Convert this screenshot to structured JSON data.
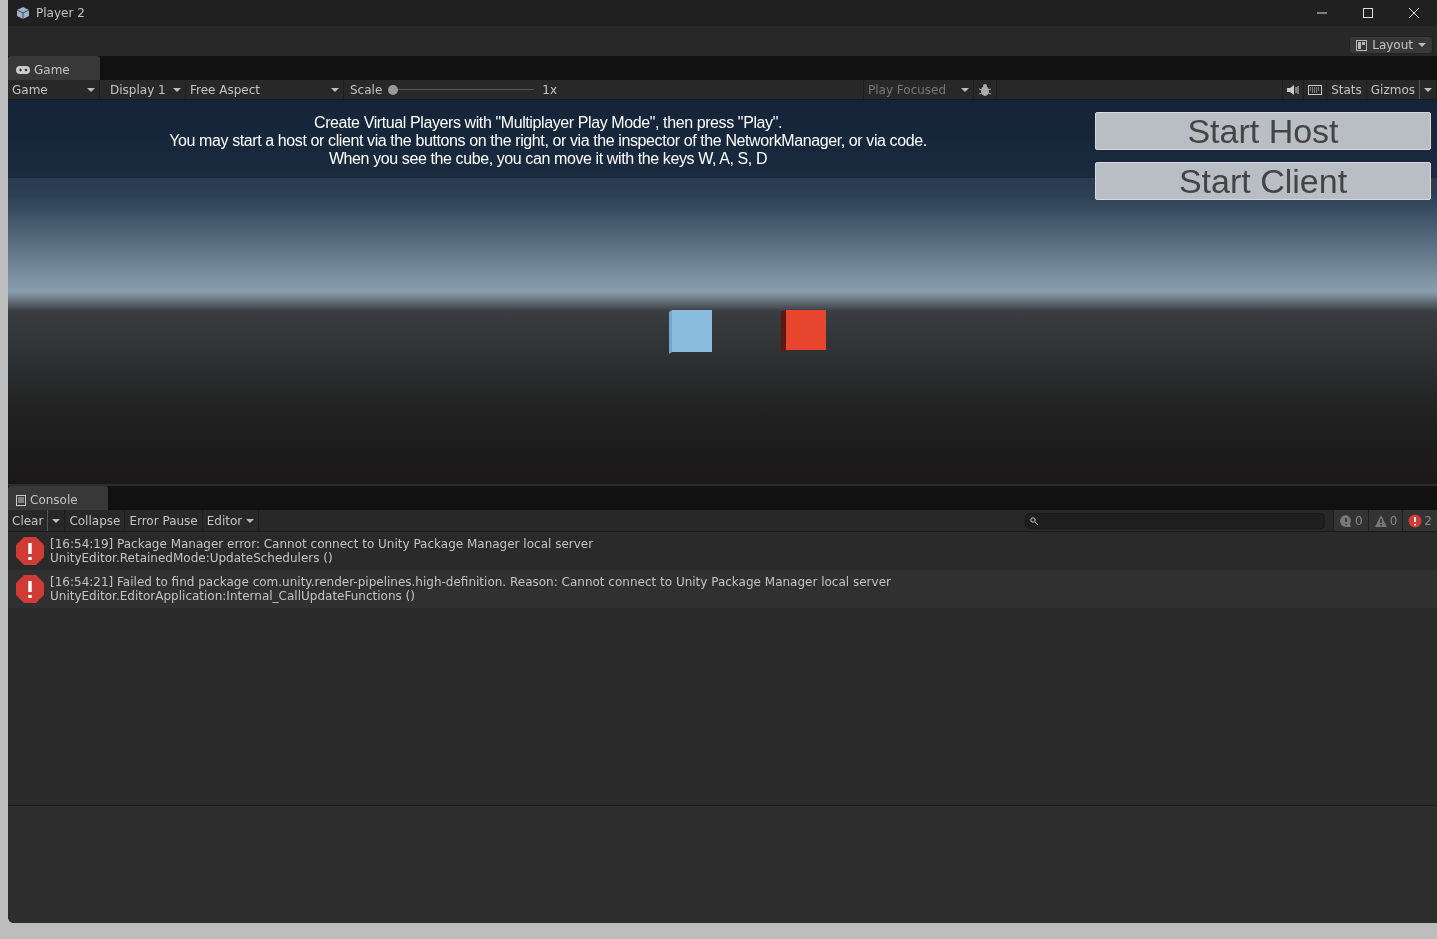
{
  "window": {
    "title": "Player 2"
  },
  "layout_button": {
    "label": "Layout"
  },
  "game_tab": {
    "label": "Game"
  },
  "game_toolbar": {
    "view": "Game",
    "display": "Display 1",
    "aspect": "Free Aspect",
    "scale": {
      "label": "Scale",
      "level": 0,
      "reading": "1x"
    },
    "play_mode": "Play Focused",
    "stats": "Stats",
    "gizmos": "Gizmos"
  },
  "game_view": {
    "message_lines": [
      "Create Virtual Players with \"Multiplayer Play Mode\", then press \"Play\".",
      "You may start a host or client via the buttons on the right, or via the inspector of the NetworkManager, or via code.",
      "When you see the cube, you can move it with the keys W, A, S, D"
    ],
    "buttons": [
      "Start Host",
      "Start Client"
    ]
  },
  "console": {
    "tab": "Console",
    "toolbar": {
      "clear": "Clear",
      "collapse": "Collapse",
      "error_pause": "Error Pause",
      "editor": "Editor"
    },
    "counts": [
      {
        "kind": "info",
        "count": "0"
      },
      {
        "kind": "warning",
        "count": "0"
      },
      {
        "kind": "error",
        "count": "2"
      }
    ],
    "logs": [
      {
        "kind": "error",
        "message": "[16:54:19] Package Manager error: Cannot connect to Unity Package Manager local server",
        "stack": "UnityEditor.RetainedMode:UpdateSchedulers ()"
      },
      {
        "kind": "error",
        "message": "[16:54:21] Failed to find package com.unity.render-pipelines.high-definition. Reason: Cannot connect to Unity Package Manager local server",
        "stack": "UnityEditor.EditorApplication:Internal_CallUpdateFunctions ()"
      }
    ]
  }
}
